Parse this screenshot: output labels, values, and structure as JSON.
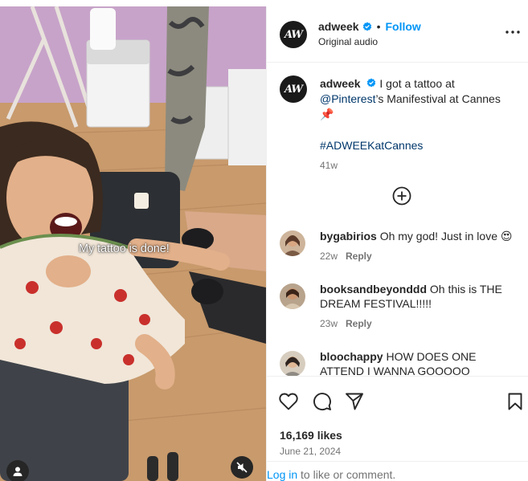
{
  "video": {
    "caption_overlay": "My tattoo is done!"
  },
  "header": {
    "avatar_text": "AW",
    "username": "adweek",
    "separator": "•",
    "follow_label": "Follow",
    "audio_label": "Original audio"
  },
  "post_caption": {
    "username": "adweek",
    "text_before": "I got a tattoo at",
    "mention": "@Pinterest",
    "text_after": "’s Manifestival at Cannes",
    "emoji": "📌",
    "hashtag": "#ADWEEKatCannes",
    "time": "41w"
  },
  "comments": [
    {
      "username": "bygabirios",
      "text": "Oh my god! Just in love 😍",
      "time": "22w",
      "reply_label": "Reply"
    },
    {
      "username": "booksandbeyonddd",
      "text": "Oh this is THE DREAM FESTIVAL!!!!!",
      "time": "23w",
      "reply_label": "Reply"
    },
    {
      "username": "bloochappy",
      "text": "HOW DOES ONE ATTEND I WANNA GOOOOO",
      "time": "",
      "reply_label": ""
    }
  ],
  "footer": {
    "likes": "16,169 likes",
    "date": "June 21, 2024",
    "login_link": "Log in",
    "login_rest": " to like or comment."
  },
  "colors": {
    "accent": "#0095f6",
    "link": "#00376b",
    "verified": "#0095f6"
  }
}
